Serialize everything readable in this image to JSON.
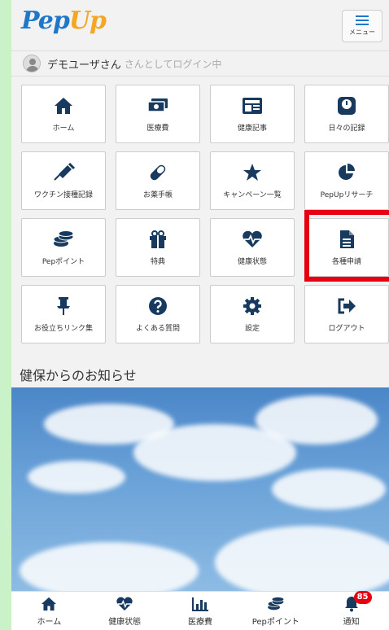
{
  "header": {
    "logo": "Pep",
    "logo_accent": "Up",
    "menu_label": "メニュー"
  },
  "user": {
    "name": "デモユーザさん",
    "login_text": "さんとしてログイン中"
  },
  "grid": [
    {
      "label": "ホーム",
      "icon": "home-icon"
    },
    {
      "label": "医療費",
      "icon": "money-icon"
    },
    {
      "label": "健康記事",
      "icon": "article-icon"
    },
    {
      "label": "日々の記録",
      "icon": "scale-icon"
    },
    {
      "label": "ワクチン接種記録",
      "icon": "syringe-icon"
    },
    {
      "label": "お薬手帳",
      "icon": "pill-icon"
    },
    {
      "label": "キャンペーン一覧",
      "icon": "star-icon"
    },
    {
      "label": "PepUpリサーチ",
      "icon": "pie-chart-icon"
    },
    {
      "label": "Pepポイント",
      "icon": "coins-icon"
    },
    {
      "label": "特典",
      "icon": "gift-icon"
    },
    {
      "label": "健康状態",
      "icon": "heartbeat-icon"
    },
    {
      "label": "各種申請",
      "icon": "document-icon"
    },
    {
      "label": "お役立ちリンク集",
      "icon": "pin-icon"
    },
    {
      "label": "よくある質問",
      "icon": "question-icon"
    },
    {
      "label": "設定",
      "icon": "gear-icon"
    },
    {
      "label": "ログアウト",
      "icon": "logout-icon"
    }
  ],
  "news": {
    "title": "健保からのお知らせ"
  },
  "bottom_nav": [
    {
      "label": "ホーム",
      "icon": "home-icon"
    },
    {
      "label": "健康状態",
      "icon": "heartbeat-icon"
    },
    {
      "label": "医療費",
      "icon": "bar-chart-icon"
    },
    {
      "label": "Pepポイント",
      "icon": "coins-icon"
    },
    {
      "label": "通知",
      "icon": "bell-icon",
      "badge": "85"
    }
  ],
  "colors": {
    "primary": "#1f77c9",
    "icon": "#173a5e",
    "highlight": "#e60012",
    "frame_bg": "#c9f2c9"
  }
}
